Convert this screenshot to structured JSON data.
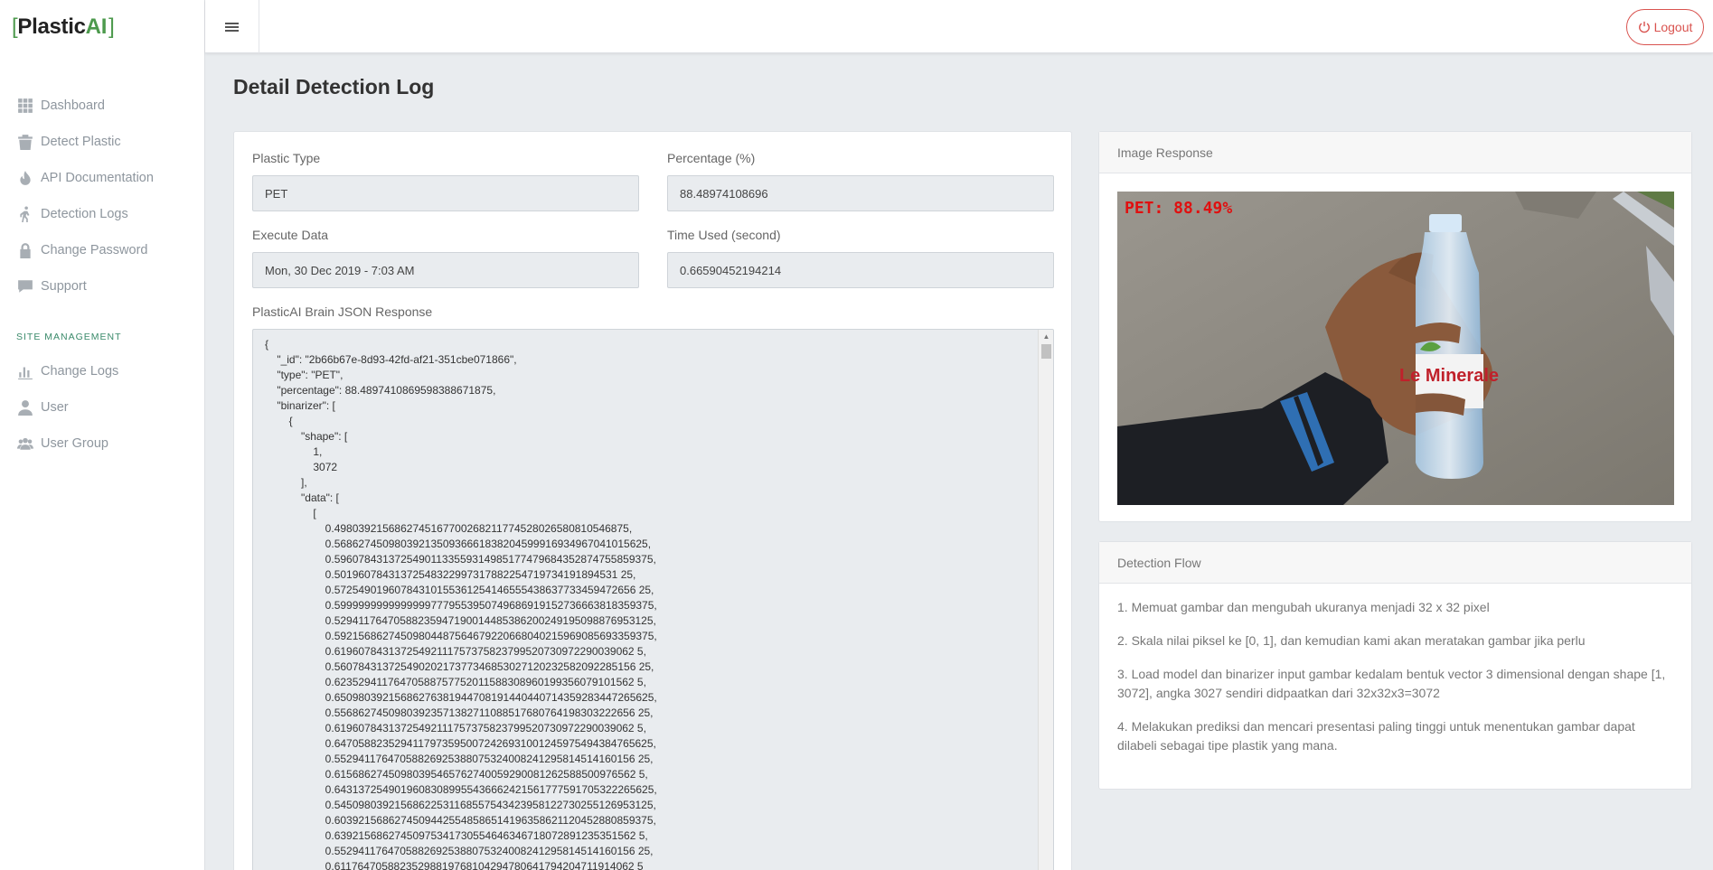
{
  "brand": {
    "name_part1": "Plastic",
    "name_part2": "AI",
    "bracket_open": "[",
    "bracket_close": "]"
  },
  "sidebar": {
    "items": [
      {
        "label": "Dashboard",
        "icon": "grid-icon"
      },
      {
        "label": "Detect Plastic",
        "icon": "trash-icon"
      },
      {
        "label": "API Documentation",
        "icon": "fire-icon"
      },
      {
        "label": "Detection Logs",
        "icon": "walking-icon"
      },
      {
        "label": "Change Password",
        "icon": "lock-icon"
      },
      {
        "label": "Support",
        "icon": "comment-icon"
      }
    ],
    "section_title": "SITE MANAGEMENT",
    "management_items": [
      {
        "label": "Change Logs",
        "icon": "bar-chart-icon"
      },
      {
        "label": "User",
        "icon": "user-icon"
      },
      {
        "label": "User Group",
        "icon": "users-icon"
      }
    ]
  },
  "topbar": {
    "logout_label": "Logout"
  },
  "page": {
    "title": "Detail Detection Log"
  },
  "form": {
    "plastic_type_label": "Plastic Type",
    "plastic_type_value": "PET",
    "percentage_label": "Percentage (%)",
    "percentage_value": "88.48974108696",
    "execute_label": "Execute Data",
    "execute_value": "Mon, 30 Dec 2019 - 7:03 AM",
    "time_label": "Time Used (second)",
    "time_value": "0.66590452194214",
    "json_label": "PlasticAI Brain JSON Response",
    "json_text": "{\n    \"_id\": \"2b66b67e-8d93-42fd-af21-351cbe071866\",\n    \"type\": \"PET\",\n    \"percentage\": 88.4897410869598388671875,\n    \"binarizer\": [\n        {\n            \"shape\": [\n                1,\n                3072\n            ],\n            \"data\": [\n                [\n                    0.4980392156862745167700268211774528026580810546875,\n                    0.5686274509803921350936661838204599916934967041015625,\n                    0.59607843137254901133559314985177479684352874755859375,\n                    0.50196078431372548322997317882254719734191894531 25,\n                    0.57254901960784310155361254146555438637733459472656 25,\n                    0.59999999999999997779553950749686919152736663818359375,\n                    0.52941176470588235947190014485386200249195098876953125,\n                    0.59215686274509804487564679220668040215969085693359375,\n                    0.61960784313725492111757375823799520730972290039062 5,\n                    0.56078431372549020217377346853027120232582092285156 25,\n                    0.62352941176470588757752011588308960199356079101562 5,\n                    0.65098039215686276381944708191440440714359283447265625,\n                    0.55686274509803923571382711088517680764198303222656 25,\n                    0.61960784313725492111757375823799520730972290039062 5,\n                    0.64705882352941179735950072426931001245975494384765625,\n                    0.55294117647058826925388075324008241295814514160156 25,\n                    0.61568627450980395465762740059290081262588500976562 5,\n                    0.64313725490196083089955436662421561777591705322265625,\n                    0.54509803921568622531168557543423958122730255126953125,\n                    0.60392156862745094425548586514196358621120452880859375,\n                    0.63921568627450975341730554646346718072891235351562 5,\n                    0.55294117647058826925388075324008241295814514160156 25,\n                    0.61176470588235298819768104294780641794204711914062 5"
  },
  "image_card": {
    "title": "Image Response",
    "overlay_text": "PET: 88.49%",
    "bottle_brand": "Le Minerale"
  },
  "flow_card": {
    "title": "Detection Flow",
    "steps": [
      "1. Memuat gambar dan mengubah ukuranya menjadi 32 x 32 pixel",
      "2. Skala nilai piksel ke [0, 1], dan kemudian kami akan meratakan gambar jika perlu",
      "3. Load model dan binarizer input gambar kedalam bentuk vector 3 dimensional dengan shape [1, 3072], angka 3027 sendiri didpaatkan dari 32x32x3=3072",
      "4. Melakukan prediksi dan mencari presentasi paling tinggi untuk menentukan gambar dapat dilabeli sebagai tipe plastik yang mana."
    ]
  }
}
